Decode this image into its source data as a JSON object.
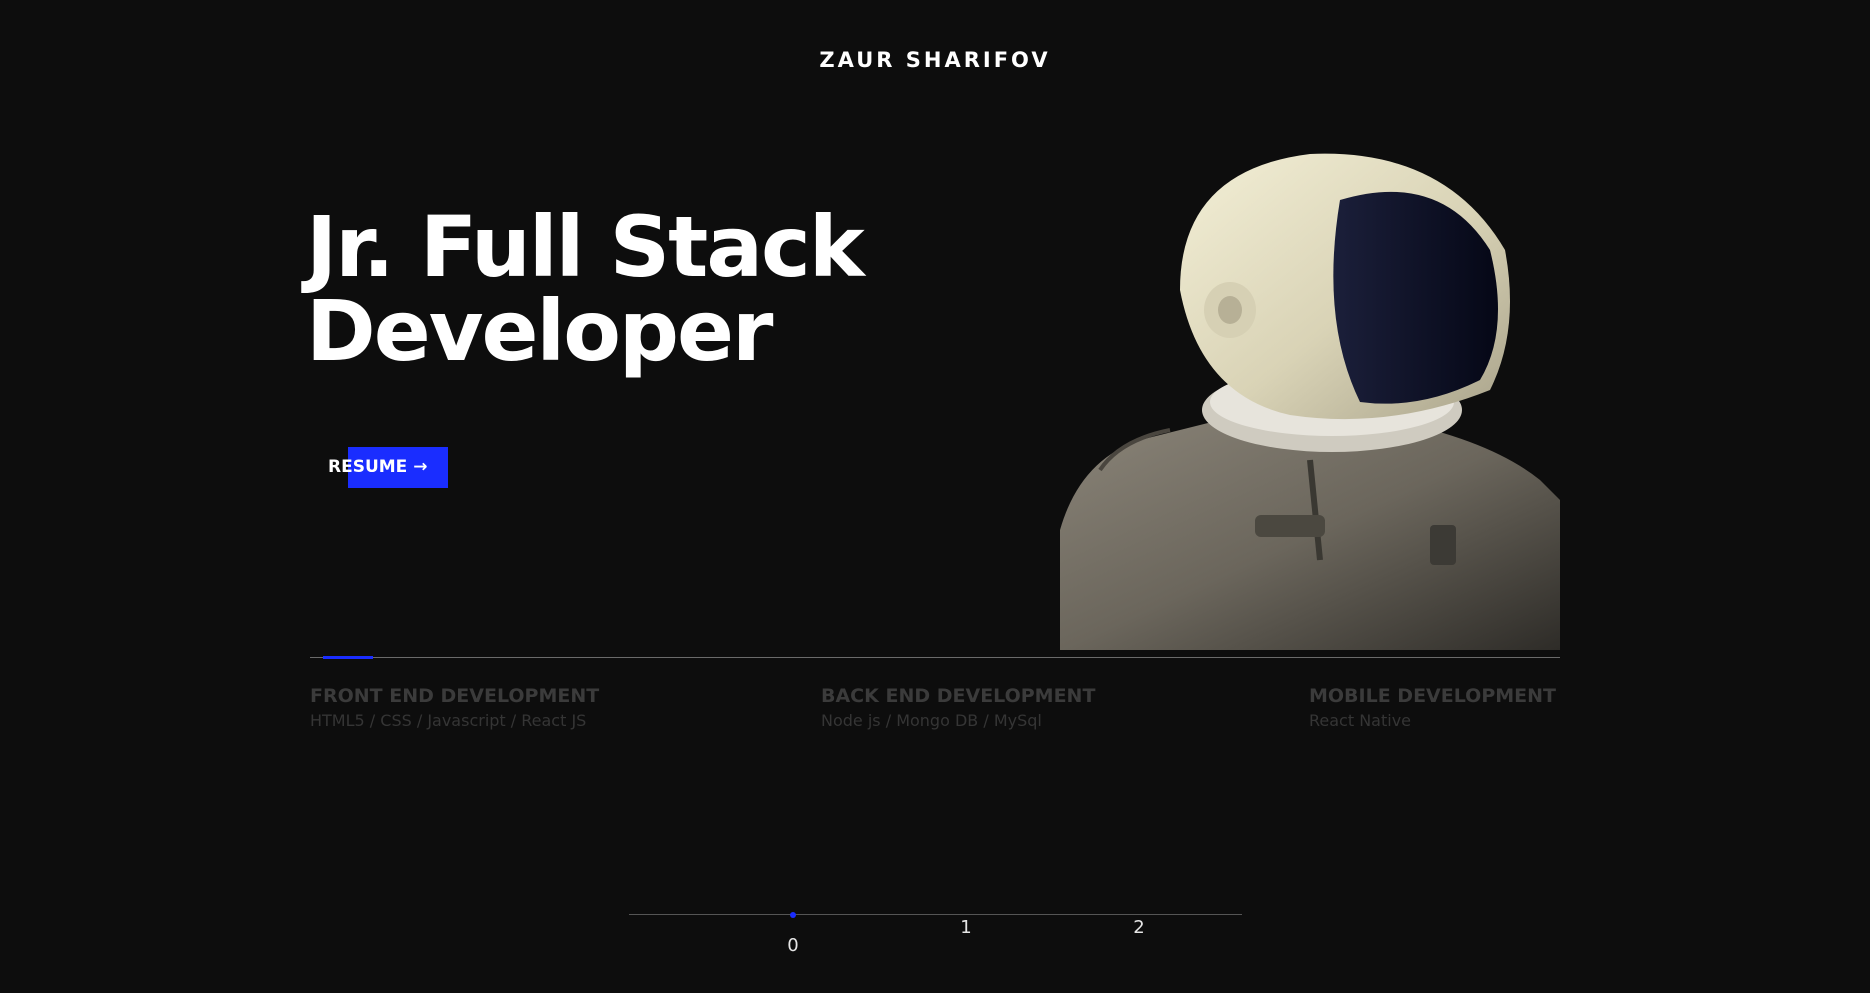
{
  "header": {
    "brand": "ZAUR SHARIFOV"
  },
  "hero": {
    "title_line_1": "Jr. Full Stack",
    "title_line_2": "Developer",
    "resume_label": "RESUME →",
    "image": "astronaut-helmet-photo"
  },
  "services": [
    {
      "title": "FRONT END DEVELOPMENT",
      "subtitle": "HTML5 / CSS / Javascript / React JS"
    },
    {
      "title": "BACK END DEVELOPMENT",
      "subtitle": "Node js / Mongo DB / MySql"
    },
    {
      "title": "MOBILE DEVELOPMENT",
      "subtitle": "React Native"
    }
  ],
  "pager": {
    "labels": [
      "0",
      "1",
      "2"
    ],
    "active_index": 0
  },
  "colors": {
    "background": "#0d0d0d",
    "accent": "#1a2dff",
    "muted_text": "#3b3b3b"
  }
}
